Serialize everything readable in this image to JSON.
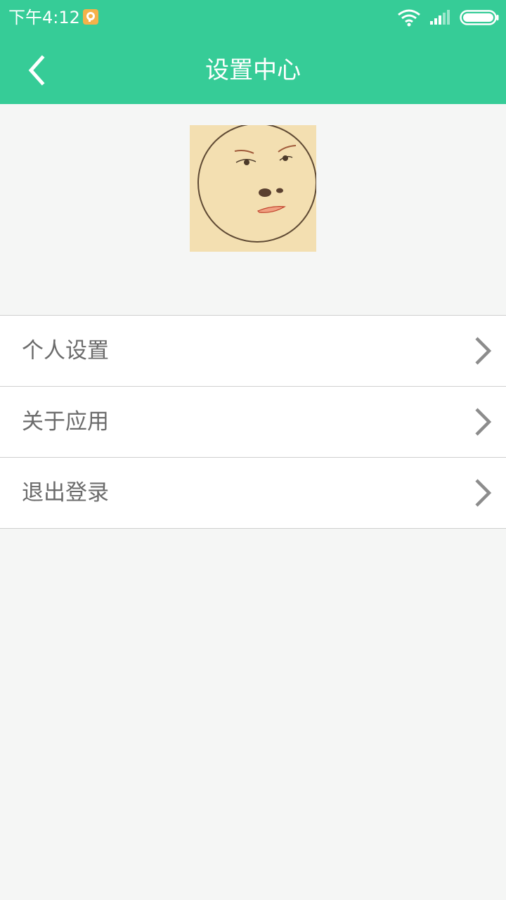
{
  "status_bar": {
    "time": "下午4:12",
    "icons": [
      "notification-icon",
      "wifi-icon",
      "signal-icon",
      "battery-icon"
    ]
  },
  "header": {
    "title": "设置中心",
    "back_icon": "chevron-left-icon"
  },
  "profile": {
    "avatar": "face-avatar-image"
  },
  "menu": {
    "items": [
      {
        "label": "个人设置",
        "icon": "chevron-right-icon"
      },
      {
        "label": "关于应用",
        "icon": "chevron-right-icon"
      },
      {
        "label": "退出登录",
        "icon": "chevron-right-icon"
      }
    ]
  },
  "colors": {
    "primary": "#36cc97",
    "background": "#f5f6f5",
    "text": "#6b6b6b",
    "divider": "#cfcfcf"
  }
}
